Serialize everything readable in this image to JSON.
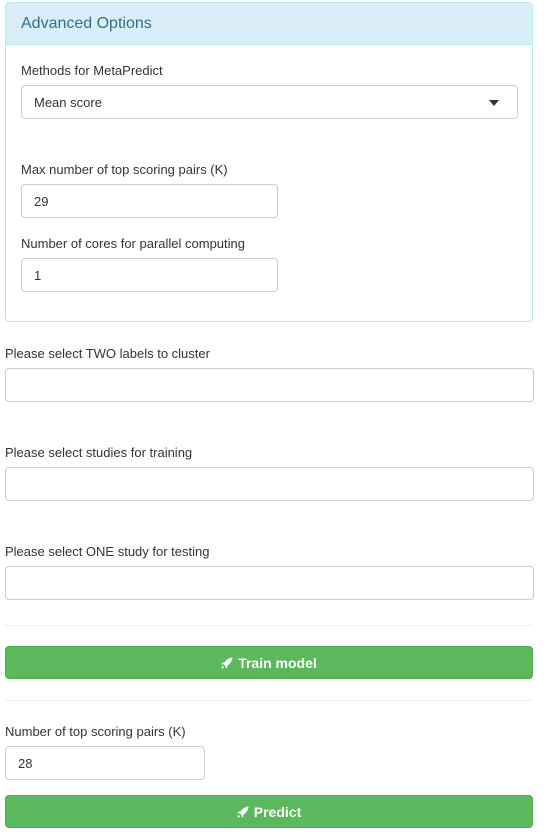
{
  "advanced_options": {
    "title": "Advanced Options",
    "methods_label": "Methods for MetaPredict",
    "methods_selected": "Mean score",
    "max_pairs_label": "Max number of top scoring pairs (K)",
    "max_pairs_value": "29",
    "cores_label": "Number of cores for parallel computing",
    "cores_value": "1"
  },
  "labels_select": {
    "label": "Please select TWO labels to cluster",
    "value": ""
  },
  "training_select": {
    "label": "Please select studies for training",
    "value": ""
  },
  "testing_select": {
    "label": "Please select ONE study for testing",
    "value": ""
  },
  "train_button": {
    "label": "Train model",
    "icon": "rocket-icon"
  },
  "top_pairs": {
    "label": "Number of top scoring pairs (K)",
    "value": "28"
  },
  "predict_button": {
    "label": "Predict",
    "icon": "rocket-icon"
  },
  "colors": {
    "panel_heading_bg": "#d9edf7",
    "panel_heading_text": "#31708f",
    "button_green": "#5cb85c"
  }
}
